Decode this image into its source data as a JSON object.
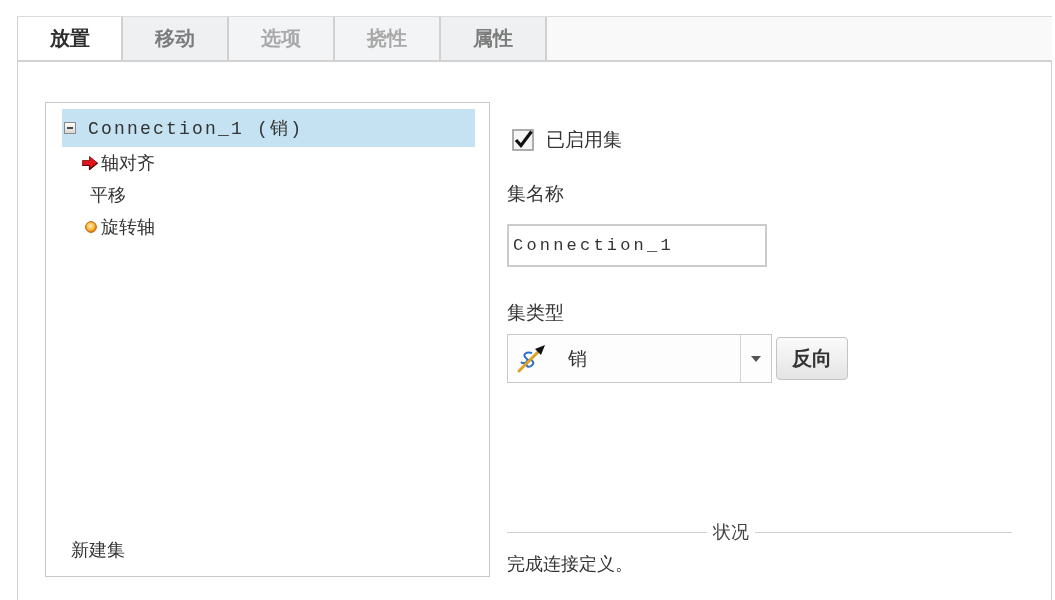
{
  "tabs": [
    {
      "label": "放置",
      "selected": true,
      "disabled": false
    },
    {
      "label": "移动",
      "selected": false,
      "disabled": false
    },
    {
      "label": "选项",
      "selected": false,
      "disabled": true
    },
    {
      "label": "挠性",
      "selected": false,
      "disabled": true
    },
    {
      "label": "属性",
      "selected": false,
      "disabled": false
    }
  ],
  "connection_tree": {
    "items": [
      {
        "label": "Connection_1 (销)",
        "expanded": true,
        "selected": true,
        "children": [
          {
            "label": "轴对齐",
            "kind": "arrow",
            "selected": false
          },
          {
            "label": "平移",
            "kind": "plain",
            "selected": false
          },
          {
            "label": "旋转轴",
            "kind": "dot",
            "selected": false
          }
        ]
      }
    ],
    "new_set": "新建集"
  },
  "set_enabled": {
    "label": "已启用集",
    "checked": true
  },
  "set_name": {
    "label": "集名称",
    "value": "Connection_1"
  },
  "set_type": {
    "label": "集类型",
    "value": "销",
    "button": "反向"
  },
  "status": {
    "title": "状况",
    "message": "完成连接定义。"
  }
}
